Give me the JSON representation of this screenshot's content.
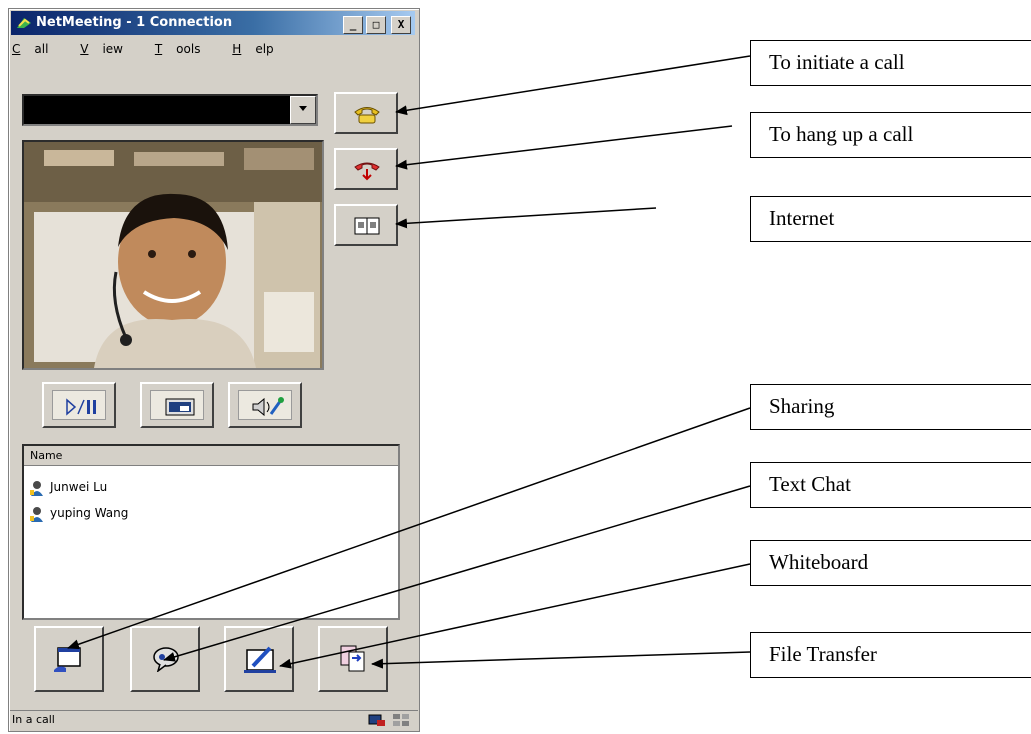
{
  "window": {
    "title": "NetMeeting - 1 Connection",
    "controls": {
      "minimize": "_",
      "maximize": "□",
      "close": "X"
    }
  },
  "menu": [
    {
      "accel": "C",
      "rest": "all"
    },
    {
      "accel": "V",
      "rest": "iew"
    },
    {
      "accel": "T",
      "rest": "ools"
    },
    {
      "accel": "H",
      "rest": "elp"
    }
  ],
  "address_bar": {
    "value": ""
  },
  "participants": {
    "header": "Name",
    "items": [
      "Junwei Lu",
      "yuping Wang"
    ]
  },
  "status": {
    "text": "In a call"
  },
  "callouts": {
    "initiate": "To initiate a call",
    "hangup": "To hang up a call",
    "internet": "Internet",
    "sharing": "Sharing",
    "chat": "Text Chat",
    "whiteboard": "Whiteboard",
    "transfer": "File Transfer"
  },
  "icons": {
    "call": "phone-icon",
    "hangup": "hang-up-icon",
    "directory": "address-book-icon",
    "play_pause": "play-pause-icon",
    "picture_in_picture": "picture-in-picture-icon",
    "audio_tuning": "audio-tuning-icon",
    "sharing": "sharing-icon",
    "chat": "chat-icon",
    "whiteboard": "whiteboard-icon",
    "file_transfer": "file-transfer-icon"
  },
  "colors": {
    "title_bar": "#0a246a",
    "window_face": "#d4d0c8",
    "address_field": "#000000"
  }
}
